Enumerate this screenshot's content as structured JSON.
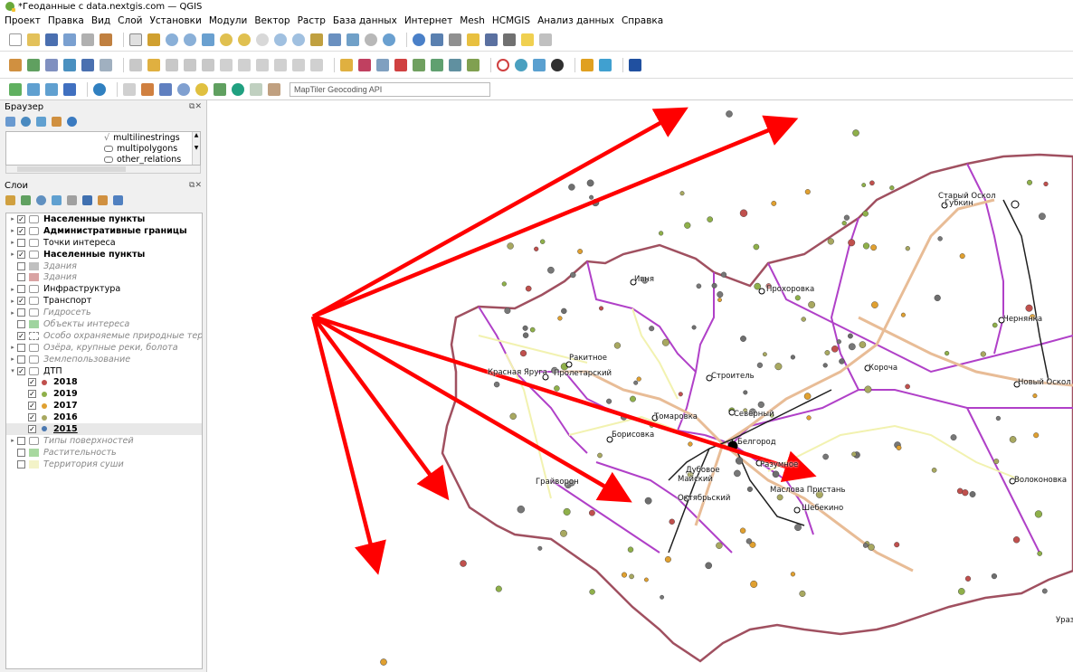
{
  "window": {
    "title": "*Геоданные с data.nextgis.com — QGIS"
  },
  "menu": [
    "Проект",
    "Правка",
    "Вид",
    "Слой",
    "Установки",
    "Модули",
    "Вектор",
    "Растр",
    "База данных",
    "Интернет",
    "Mesh",
    "HCMGIS",
    "Анализ данных",
    "Справка"
  ],
  "toolbar": {
    "geocoder_text": "MapTiler Geocoding API"
  },
  "browser": {
    "title": "Браузер",
    "items": [
      {
        "label": "multilinestrings"
      },
      {
        "label": "multipolygons"
      },
      {
        "label": "other_relations"
      }
    ]
  },
  "layers_panel": {
    "title": "Слои"
  },
  "layers": [
    {
      "label": "Населенные пункты",
      "checked": true,
      "bold": true,
      "italic": false,
      "expand": "▸",
      "indent": 0
    },
    {
      "label": "Административные границы",
      "checked": true,
      "bold": true,
      "italic": false,
      "expand": "▸",
      "indent": 0
    },
    {
      "label": "Точки интереса",
      "checked": false,
      "bold": false,
      "italic": false,
      "expand": "▸",
      "indent": 0
    },
    {
      "label": "Населенные пункты",
      "checked": true,
      "bold": true,
      "italic": false,
      "expand": "▸",
      "indent": 0
    },
    {
      "label": "Здания",
      "checked": false,
      "bold": false,
      "italic": true,
      "expand": "",
      "indent": 0,
      "swatch": "#c0c0c0"
    },
    {
      "label": "Здания",
      "checked": false,
      "bold": false,
      "italic": true,
      "expand": "",
      "indent": 0,
      "swatch": "#d9a3a3"
    },
    {
      "label": "Инфраструктура",
      "checked": false,
      "bold": false,
      "italic": false,
      "expand": "▸",
      "indent": 0
    },
    {
      "label": "Транспорт",
      "checked": true,
      "bold": false,
      "italic": false,
      "expand": "▸",
      "indent": 0
    },
    {
      "label": "Гидросеть",
      "checked": false,
      "bold": false,
      "italic": true,
      "expand": "▸",
      "indent": 0
    },
    {
      "label": "Объекты интереса",
      "checked": false,
      "bold": false,
      "italic": true,
      "expand": "",
      "indent": 0,
      "swatch": "#9fd49f"
    },
    {
      "label": "Особо охраняемые природные террит",
      "checked": true,
      "bold": false,
      "italic": true,
      "expand": "",
      "indent": 0,
      "swatch": "dash"
    },
    {
      "label": "Озёра, крупные реки, болота",
      "checked": false,
      "bold": false,
      "italic": true,
      "expand": "▸",
      "indent": 0
    },
    {
      "label": "Землепользование",
      "checked": false,
      "bold": false,
      "italic": true,
      "expand": "▸",
      "indent": 0
    },
    {
      "label": "ДТП",
      "checked": true,
      "bold": false,
      "italic": false,
      "expand": "▾",
      "indent": 0
    },
    {
      "label": "2018",
      "checked": true,
      "bold": true,
      "italic": false,
      "expand": "",
      "indent": 1,
      "dot": "#c0504d"
    },
    {
      "label": "2019",
      "checked": true,
      "bold": true,
      "italic": false,
      "expand": "",
      "indent": 1,
      "dot": "#8fb04a"
    },
    {
      "label": "2017",
      "checked": true,
      "bold": true,
      "italic": false,
      "expand": "",
      "indent": 1,
      "dot": "#e0a030"
    },
    {
      "label": "2016",
      "checked": true,
      "bold": true,
      "italic": false,
      "expand": "",
      "indent": 1,
      "dot": "#a8a860"
    },
    {
      "label": "2015",
      "checked": true,
      "bold": true,
      "italic": false,
      "expand": "",
      "indent": 1,
      "dot": "#4a78b0",
      "selected": true
    },
    {
      "label": "Типы поверхностей",
      "checked": false,
      "bold": false,
      "italic": true,
      "expand": "▸",
      "indent": 0
    },
    {
      "label": "Растительность",
      "checked": false,
      "bold": false,
      "italic": true,
      "expand": "",
      "indent": 0,
      "swatch": "#a8d8a0"
    },
    {
      "label": "Территория суши",
      "checked": false,
      "bold": false,
      "italic": true,
      "expand": "",
      "indent": 0,
      "swatch": "#f3f3c8"
    }
  ],
  "map_labels": [
    {
      "text": "Старый Оскол"
    },
    {
      "text": "Губкин"
    },
    {
      "text": "Ивня"
    },
    {
      "text": "Прохоровка"
    },
    {
      "text": "Чернянка"
    },
    {
      "text": "Ракитное"
    },
    {
      "text": "Красная Яруга"
    },
    {
      "text": "Пролетарский"
    },
    {
      "text": "Строитель"
    },
    {
      "text": "Короча"
    },
    {
      "text": "Новый Оскол"
    },
    {
      "text": "Томаровка"
    },
    {
      "text": "Северный"
    },
    {
      "text": "Борисовка"
    },
    {
      "text": "Белгород"
    },
    {
      "text": "Дубовое"
    },
    {
      "text": "Разумное"
    },
    {
      "text": "Майский"
    },
    {
      "text": "Грайворон"
    },
    {
      "text": "Маслова Пристань"
    },
    {
      "text": "Волоконовка"
    },
    {
      "text": "Октябрьский"
    },
    {
      "text": "Шебекино"
    },
    {
      "text": "Уразово"
    }
  ],
  "colors": {
    "arrow": "#ff0000",
    "boundary_district": "#b040c8",
    "boundary_region": "#a05060",
    "road_main": "#e8bc96",
    "road_minor": "#f2f2b0",
    "rail": "#202020"
  }
}
